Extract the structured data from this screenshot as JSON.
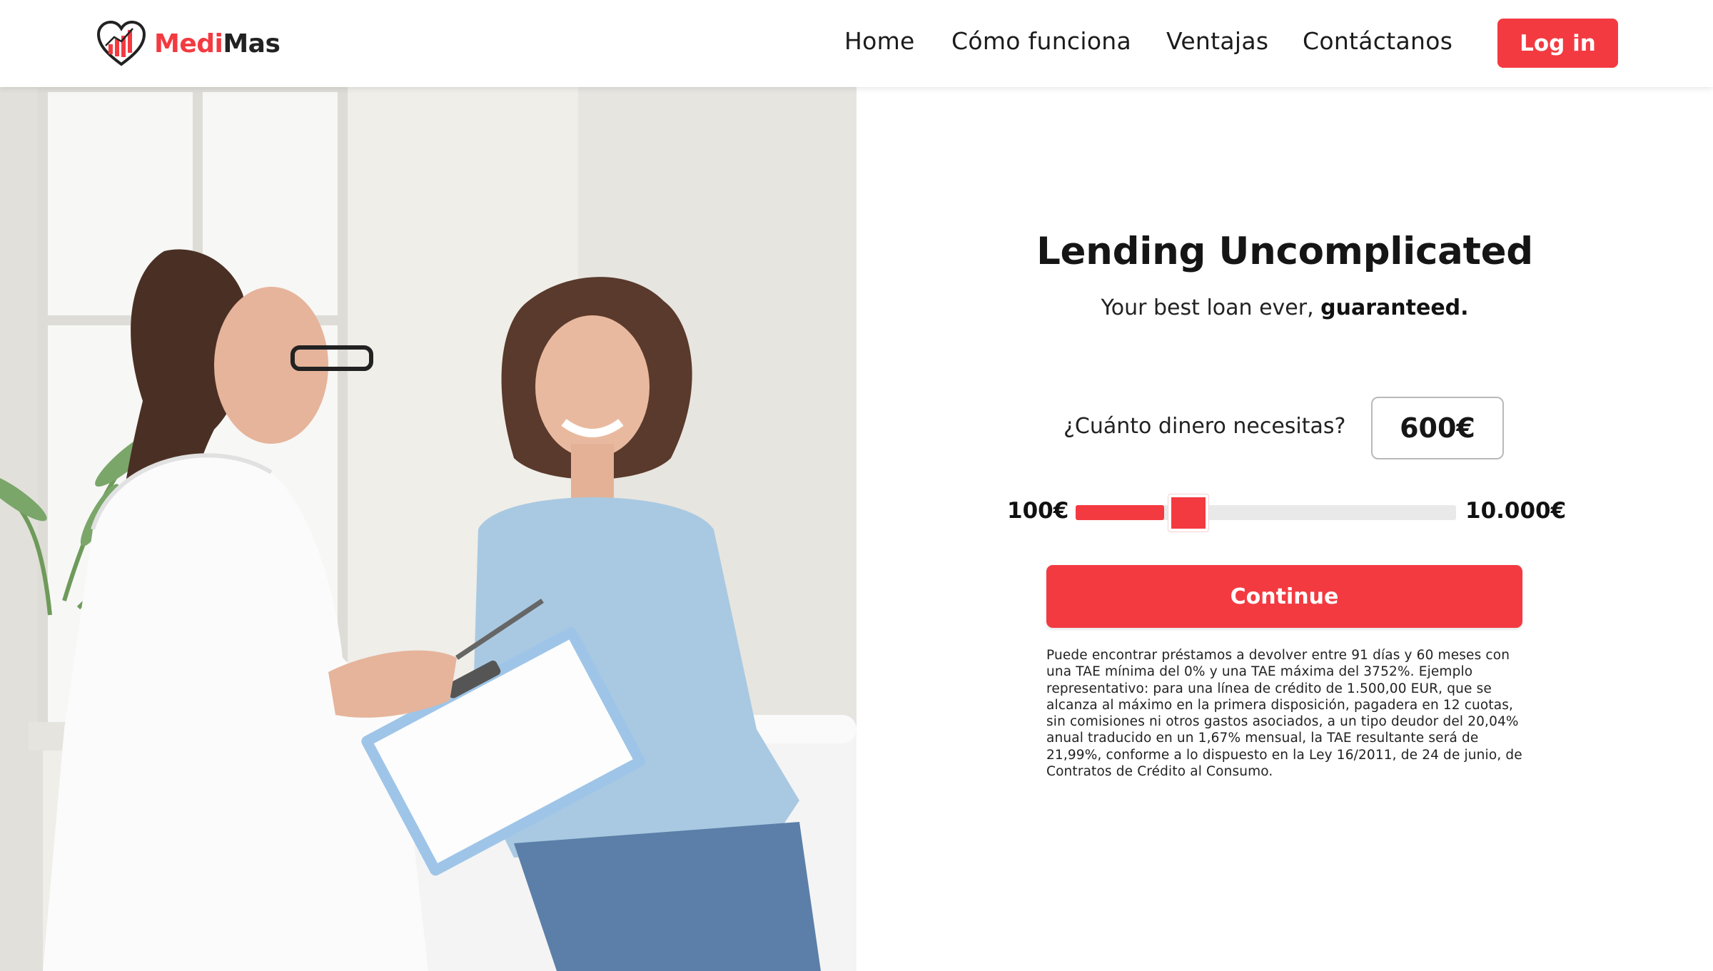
{
  "brand": {
    "name_part1": "Medi",
    "name_part2": "Mas",
    "accent": "#f33a41",
    "logo_icon": "heart-bar-chart-icon"
  },
  "nav": {
    "items": [
      {
        "label": "Home"
      },
      {
        "label": "Cómo funciona"
      },
      {
        "label": "Ventajas"
      },
      {
        "label": "Contáctanos"
      }
    ],
    "login_label": "Log in"
  },
  "hero": {
    "image_alt": "doctor-consultation-photo"
  },
  "form": {
    "title": "Lending Uncomplicated",
    "subtitle_regular": "Your best loan ever,",
    "subtitle_bold": "guaranteed.",
    "question": "¿Cuánto dinero necesitas?",
    "amount_display": "600€",
    "slider": {
      "min_label": "100€",
      "max_label": "10.000€",
      "min": 100,
      "max": 10000,
      "value": 600
    },
    "continue_label": "Continue",
    "legal_text": "Puede encontrar préstamos a devolver entre 91 días y 60 meses con una TAE mínima del 0% y una TAE máxima del 3752%. Ejemplo representativo: para una línea de crédito de 1.500,00 EUR, que se alcanza al máximo en la primera disposición, pagadera en 12 cuotas, sin comisiones ni otros gastos asociados, a un tipo deudor del 20,04% anual traducido en un 1,67% mensual, la TAE resultante será de 21,99%, conforme a lo dispuesto en la Ley 16/2011, de 24 de junio, de Contratos de Crédito al Consumo."
  }
}
